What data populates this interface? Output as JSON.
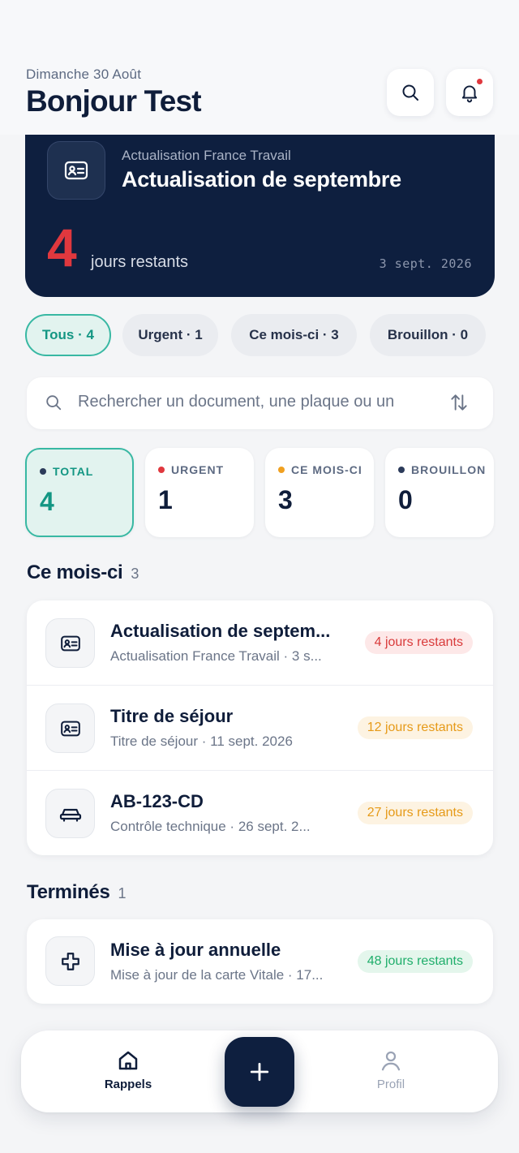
{
  "header": {
    "date": "Dimanche 30 Août",
    "greeting": "Bonjour Test",
    "search_icon": "search-icon",
    "bell_icon": "bell-icon"
  },
  "hero": {
    "kicker": "Actualisation France Travail",
    "title": "Actualisation de septembre",
    "days_count": "4",
    "days_label": "jours restants",
    "due_date": "3 sept. 2026",
    "icon": "id-card-icon"
  },
  "filters": [
    {
      "label": "Tous · 4",
      "active": true
    },
    {
      "label": "Urgent · 1",
      "active": false
    },
    {
      "label": "Ce mois-ci · 3",
      "active": false
    },
    {
      "label": "Brouillon · 0",
      "active": false
    }
  ],
  "search": {
    "placeholder": "Rechercher un document, une plaque ou un",
    "sort_icon": "sort-icon"
  },
  "stats": [
    {
      "label": "TOTAL",
      "value": "4",
      "dot_color": "#2c3b5a"
    },
    {
      "label": "URGENT",
      "value": "1",
      "dot_color": "#e0383e"
    },
    {
      "label": "CE MOIS-CI",
      "value": "3",
      "dot_color": "#f0a020"
    },
    {
      "label": "BROUILLON",
      "value": "0",
      "dot_color": "#2c3b5a"
    }
  ],
  "sections": {
    "this_month": {
      "title": "Ce mois-ci",
      "count": "3",
      "items": [
        {
          "title": "Actualisation de septem...",
          "subtitle": "Actualisation France Travail · 3 s...",
          "badge": "4 jours restants",
          "icon": "id-card-icon",
          "badge_color": "#d93a3a",
          "badge_bg": "#fde8e8"
        },
        {
          "title": "Titre de séjour",
          "subtitle": "Titre de séjour · 11 sept. 2026",
          "badge": "12 jours restants",
          "icon": "id-card-icon",
          "badge_color": "#e69a18",
          "badge_bg": "#fdf3e2"
        },
        {
          "title": "AB-123-CD",
          "subtitle": "Contrôle technique · 26 sept. 2...",
          "badge": "27 jours restants",
          "icon": "car-icon",
          "badge_color": "#e69a18",
          "badge_bg": "#fdf3e2"
        }
      ]
    },
    "done": {
      "title": "Terminés",
      "count": "1",
      "items": [
        {
          "title": "Mise à jour annuelle",
          "subtitle": "Mise à jour de la carte Vitale · 17...",
          "badge": "48 jours restants",
          "icon": "medical-cross-icon",
          "badge_color": "#1fae6b",
          "badge_bg": "#e4f6ec"
        }
      ]
    }
  },
  "nav": {
    "home_label": "Rappels",
    "profile_label": "Profil",
    "home_icon": "home-icon",
    "profile_icon": "user-icon",
    "add_icon": "plus-icon"
  },
  "colors": {
    "navy": "#0e1f3f",
    "teal": "#139683",
    "red": "#e0383e"
  }
}
